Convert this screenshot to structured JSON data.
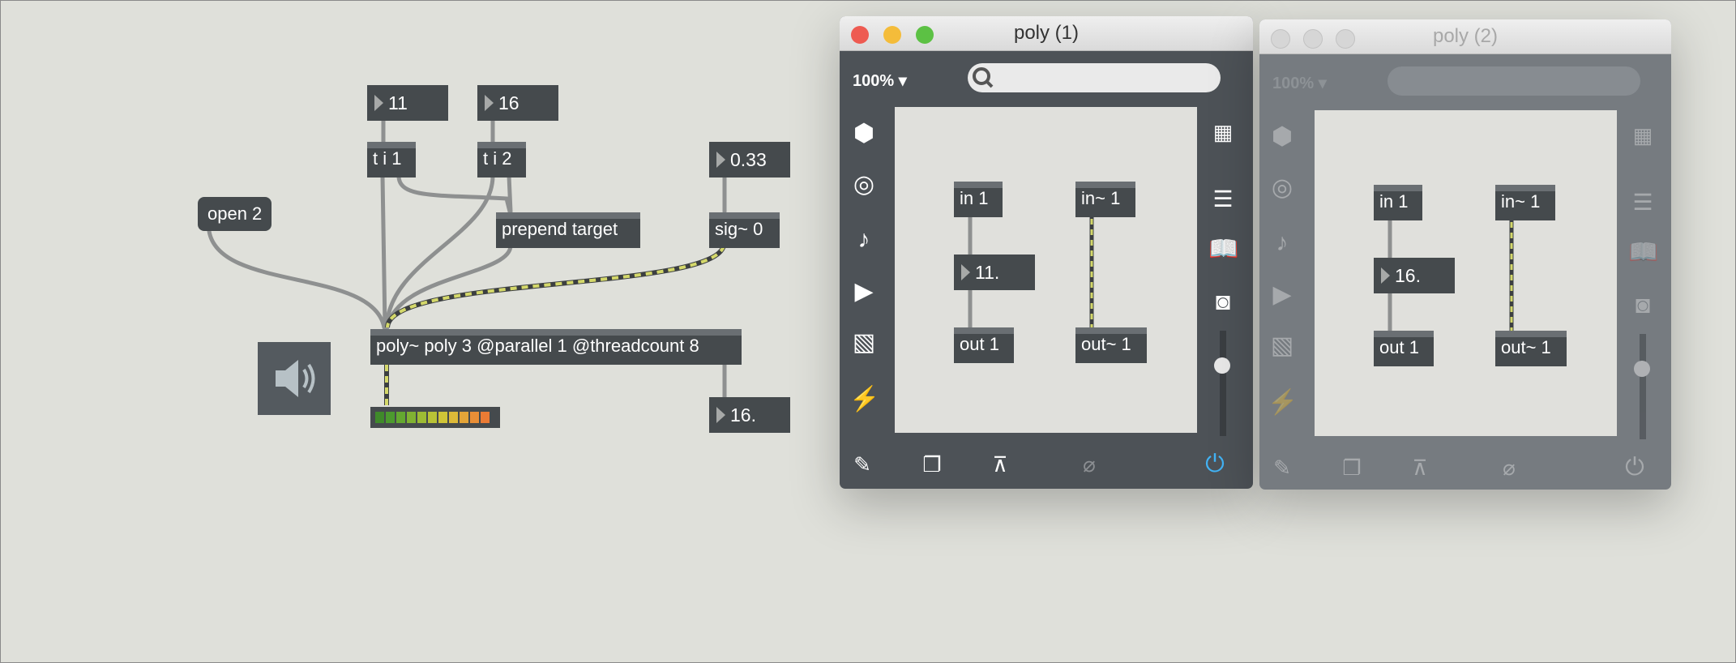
{
  "patcher": {
    "num_11": "11",
    "num_16": "16",
    "num_033": "0.33",
    "num_out": "16.",
    "ti1": "t i 1",
    "ti2": "t i 2",
    "open2": "open 2",
    "prepend": "prepend target",
    "sig": "sig~ 0",
    "poly": "poly~ poly 3 @parallel 1 @threadcount 8"
  },
  "windows": [
    {
      "title": "poly (1)",
      "zoom": "100%",
      "objects": {
        "in": "in 1",
        "in_sig": "in~ 1",
        "num": "11.",
        "out": "out 1",
        "out_sig": "out~ 1"
      }
    },
    {
      "title": "poly (2)",
      "zoom": "100%",
      "objects": {
        "in": "in 1",
        "in_sig": "in~ 1",
        "num": "16.",
        "out": "out 1",
        "out_sig": "out~ 1"
      }
    }
  ],
  "icons": [
    "speaker-icon",
    "cube-icon",
    "target-icon",
    "music-note-icon",
    "video-icon",
    "image-icon",
    "plug-icon",
    "grid-icon",
    "list-icon",
    "book-icon",
    "camera-icon",
    "pencil-icon",
    "windows-icon",
    "presentation-icon",
    "paperclip-icon",
    "power-icon",
    "search-icon"
  ],
  "colors": {
    "object": "#454a4d",
    "signal_cord": "#d4d86a",
    "power_active": "#42b3f5"
  }
}
